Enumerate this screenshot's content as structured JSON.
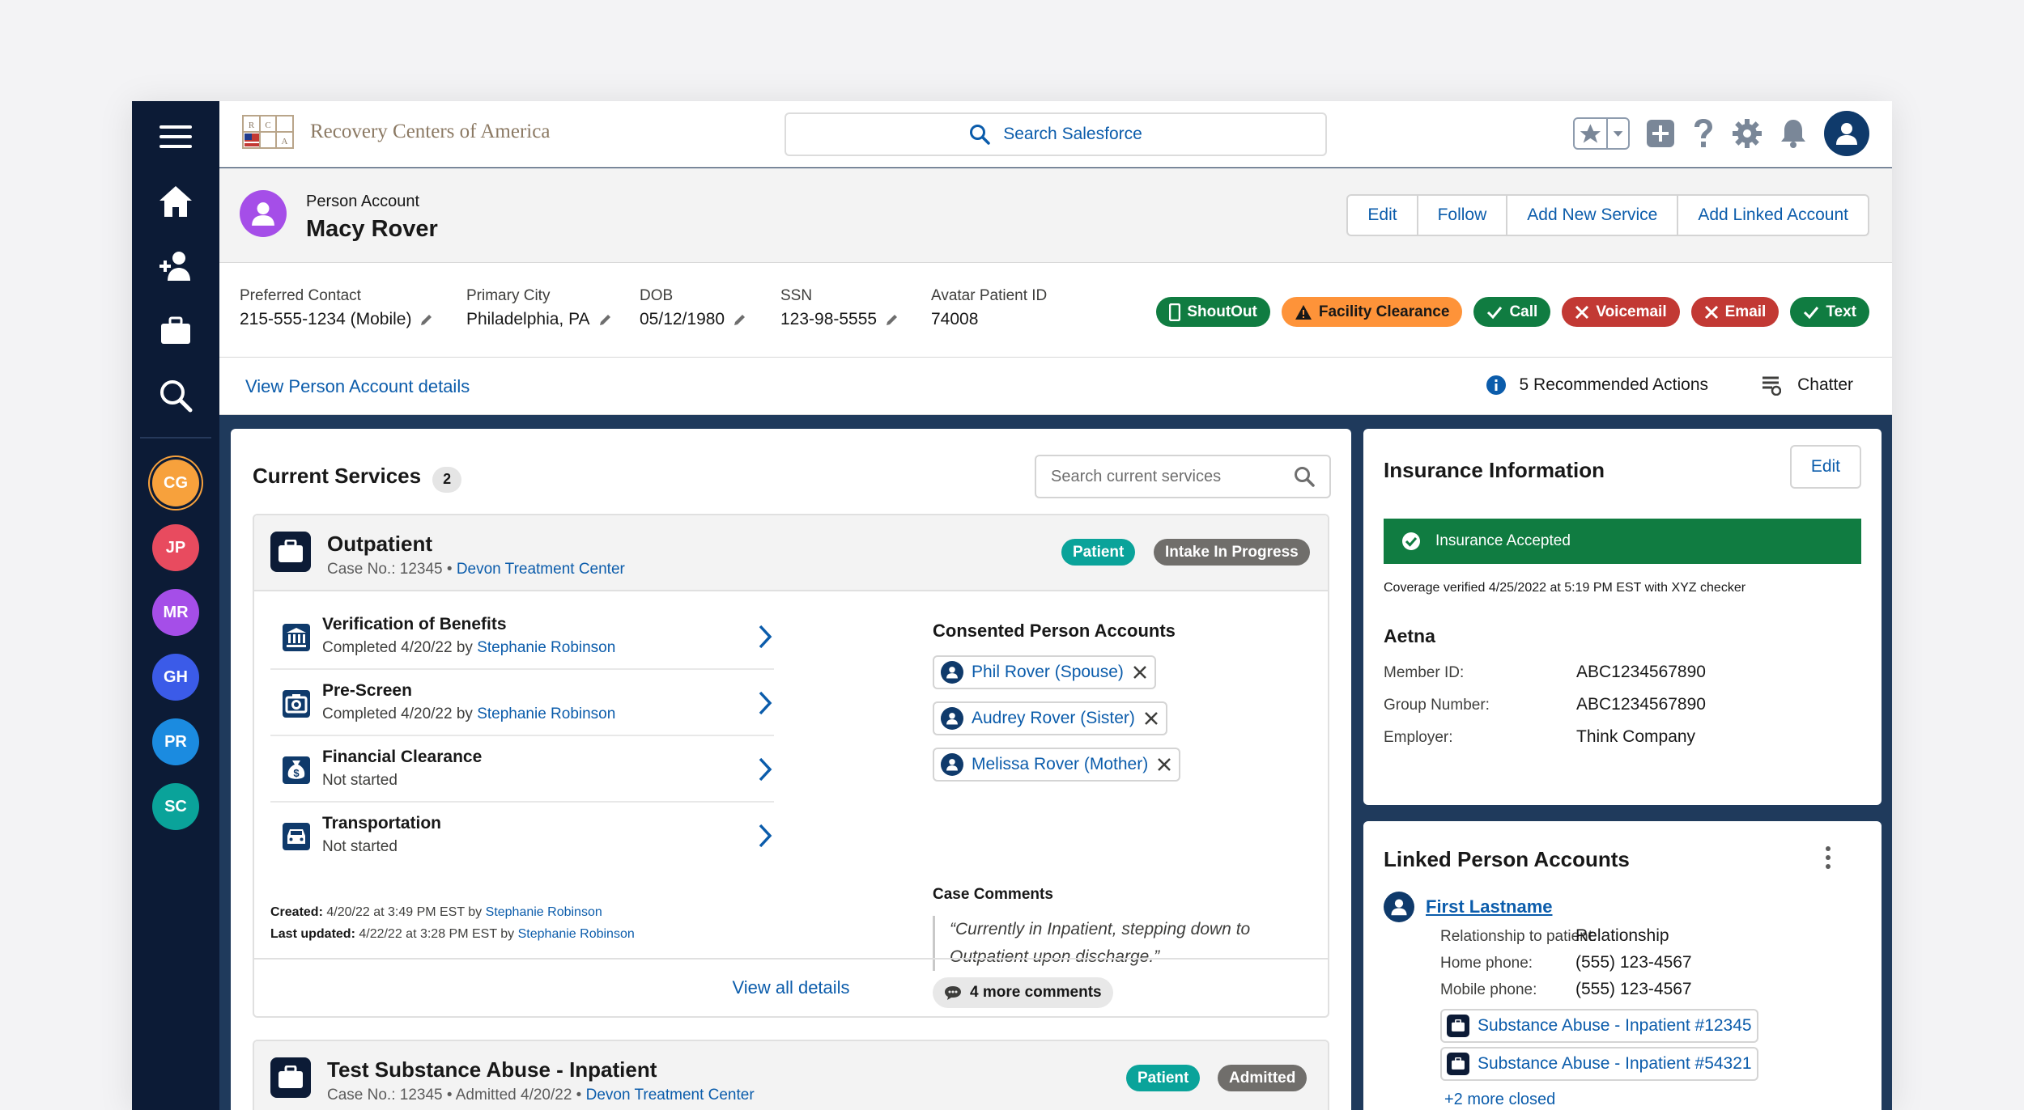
{
  "brand": {
    "name": "Recovery Centers of America",
    "logo_letters": [
      "R",
      "C",
      "A"
    ]
  },
  "search": {
    "placeholder": "Search Salesforce"
  },
  "rail": {
    "avatars": [
      {
        "initials": "CG",
        "color": "#f7a13c",
        "active": true
      },
      {
        "initials": "JP",
        "color": "#e84b5f"
      },
      {
        "initials": "MR",
        "color": "#a54ee8"
      },
      {
        "initials": "GH",
        "color": "#3b5be8"
      },
      {
        "initials": "PR",
        "color": "#1b8be0"
      },
      {
        "initials": "SC",
        "color": "#0aa39a"
      }
    ]
  },
  "header": {
    "object_type": "Person Account",
    "name": "Macy Rover",
    "buttons": [
      "Edit",
      "Follow",
      "Add New Service",
      "Add Linked Account"
    ]
  },
  "fields": [
    {
      "label": "Preferred Contact",
      "value": "215-555-1234 (Mobile)",
      "editable": true
    },
    {
      "label": "Primary City",
      "value": "Philadelphia, PA",
      "editable": true
    },
    {
      "label": "DOB",
      "value": "05/12/1980",
      "editable": true
    },
    {
      "label": "SSN",
      "value": "123-98-5555",
      "editable": true
    },
    {
      "label": "Avatar Patient ID",
      "value": "74008",
      "editable": false
    }
  ],
  "badges": [
    {
      "label": "ShoutOut",
      "color": "#107c41",
      "icon": "phone-icon"
    },
    {
      "label": "Facility Clearance",
      "color": "#fe9339",
      "icon": "warning-icon"
    },
    {
      "label": "Call",
      "color": "#107c41",
      "icon": "check-icon"
    },
    {
      "label": "Voicemail",
      "color": "#c23934",
      "icon": "x-icon"
    },
    {
      "label": "Email",
      "color": "#c23934",
      "icon": "x-icon"
    },
    {
      "label": "Text",
      "color": "#107c41",
      "icon": "check-icon"
    }
  ],
  "nav": {
    "details_link": "View Person Account details",
    "recommended": "5 Recommended Actions",
    "chatter": "Chatter"
  },
  "services": {
    "title": "Current Services",
    "count": "2",
    "search_placeholder": "Search current services",
    "case1": {
      "title": "Outpatient",
      "case_prefix": "Case No.: 12345 •",
      "center": "Devon Treatment Center",
      "tags": [
        "Patient",
        "Intake In Progress"
      ],
      "steps": [
        {
          "title": "Verification of Benefits",
          "status": "Completed 4/20/22 by",
          "by": "Stephanie Robinson",
          "icon": "bank-icon"
        },
        {
          "title": "Pre-Screen",
          "status": "Completed 4/20/22 by",
          "by": "Stephanie Robinson",
          "icon": "camera-icon"
        },
        {
          "title": "Financial Clearance",
          "status": "Not started",
          "by": "",
          "icon": "money-bag-icon"
        },
        {
          "title": "Transportation",
          "status": "Not started",
          "by": "",
          "icon": "car-icon"
        }
      ],
      "created_label": "Created:",
      "created_text": "4/20/22 at 3:49 PM EST by",
      "created_by": "Stephanie Robinson",
      "updated_label": "Last updated:",
      "updated_text": "4/22/22 at 3:28 PM EST by",
      "updated_by": "Stephanie Robinson",
      "consented_title": "Consented Person Accounts",
      "consented": [
        "Phil Rover (Spouse)",
        "Audrey Rover (Sister)",
        "Melissa Rover (Mother)"
      ],
      "comments_title": "Case Comments",
      "comment": "“Currently in Inpatient, stepping down to Outpatient upon discharge.”",
      "more_comments": "4 more comments",
      "view_all": "View all details"
    },
    "case2": {
      "title": "Test Substance Abuse - Inpatient",
      "case_prefix": "Case No.: 12345 • Admitted 4/20/22 •",
      "center": "Devon Treatment Center",
      "tags": [
        "Patient",
        "Admitted"
      ]
    }
  },
  "insurance": {
    "title": "Insurance Information",
    "edit": "Edit",
    "status": "Insurance Accepted",
    "verified": "Coverage verified 4/25/2022 at 5:19 PM EST with XYZ checker",
    "carrier": "Aetna",
    "rows": [
      {
        "label": "Member ID:",
        "value": "ABC1234567890"
      },
      {
        "label": "Group Number:",
        "value": "ABC1234567890"
      },
      {
        "label": "Employer:",
        "value": "Think Company"
      }
    ]
  },
  "linked": {
    "title": "Linked Person Accounts",
    "person": "First Lastname",
    "rows": [
      {
        "label": "Relationship to patient:",
        "value": "Relationship"
      },
      {
        "label": "Home phone:",
        "value": "(555) 123-4567"
      },
      {
        "label": "Mobile phone:",
        "value": "(555) 123-4567"
      }
    ],
    "cases": [
      "Substance Abuse - Inpatient #12345",
      "Substance Abuse - Inpatient #54321"
    ],
    "more_closed": "+2 more closed"
  },
  "colors": {
    "brand_blue": "#0b5cab",
    "rail": "#0c1b36",
    "success": "#107c41",
    "error": "#c23934",
    "warning": "#fe9339"
  }
}
